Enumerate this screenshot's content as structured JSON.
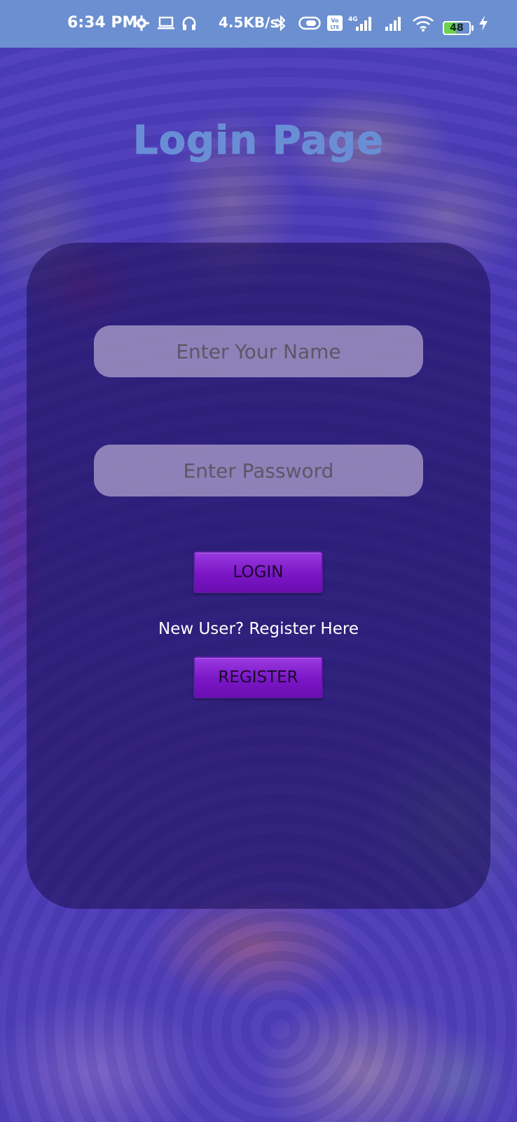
{
  "status_bar": {
    "time": "6:34 PM",
    "network_speed": "4.5KB/s",
    "battery": "48",
    "icons": [
      "settings-icon",
      "laptop-icon",
      "headphones-icon",
      "bluetooth-icon",
      "toggle-icon",
      "volte-icon",
      "signal-4g-icon",
      "signal-icon",
      "wifi-icon",
      "battery-icon",
      "charging-icon"
    ]
  },
  "page": {
    "title": "Login Page"
  },
  "form": {
    "name_placeholder": "Enter Your Name",
    "password_placeholder": "Enter Password",
    "login_label": "LOGIN",
    "register_prompt": "New User? Register Here",
    "register_label": "REGISTER"
  },
  "colors": {
    "status_bar": "#6b8fd0",
    "title": "#6a8ed6",
    "button": "#7b16c6",
    "card_overlay": "#190c50"
  }
}
